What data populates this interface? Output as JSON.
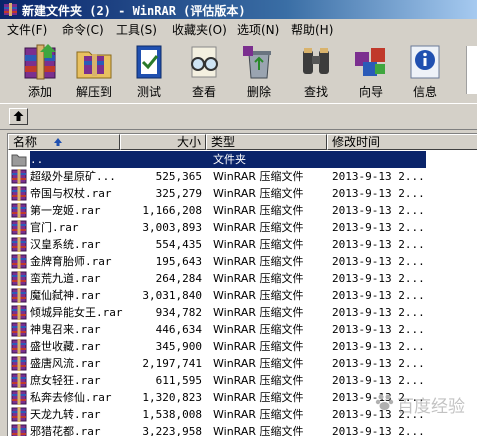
{
  "window": {
    "title": "新建文件夹 (2) - WinRAR (评估版本)"
  },
  "menu": [
    "文件(F)",
    "命令(C)",
    "工具(S)",
    "收藏夹(O)",
    "选项(N)",
    "帮助(H)"
  ],
  "toolbar": {
    "add": "添加",
    "extract": "解压到",
    "test": "测试",
    "view": "查看",
    "delete": "删除",
    "find": "查找",
    "wizard": "向导",
    "info": "信息"
  },
  "columns": {
    "name": "名称",
    "size": "大小",
    "type": "类型",
    "modified": "修改时间"
  },
  "parent_row": {
    "name": "..",
    "type": "文件夹"
  },
  "files": [
    {
      "name": "超级外星原矿...",
      "size": "525,365",
      "type": "WinRAR 压缩文件",
      "modified": "2013-9-13 2..."
    },
    {
      "name": "帝国与权杖.rar",
      "size": "325,279",
      "type": "WinRAR 压缩文件",
      "modified": "2013-9-13 2..."
    },
    {
      "name": "第一宠姬.rar",
      "size": "1,166,208",
      "type": "WinRAR 压缩文件",
      "modified": "2013-9-13 2..."
    },
    {
      "name": "官门.rar",
      "size": "3,003,893",
      "type": "WinRAR 压缩文件",
      "modified": "2013-9-13 2..."
    },
    {
      "name": "汉皇系统.rar",
      "size": "554,435",
      "type": "WinRAR 压缩文件",
      "modified": "2013-9-13 2..."
    },
    {
      "name": "金牌育胎师.rar",
      "size": "195,643",
      "type": "WinRAR 压缩文件",
      "modified": "2013-9-13 2..."
    },
    {
      "name": "蛮荒九道.rar",
      "size": "264,284",
      "type": "WinRAR 压缩文件",
      "modified": "2013-9-13 2..."
    },
    {
      "name": "魔仙弑神.rar",
      "size": "3,031,840",
      "type": "WinRAR 压缩文件",
      "modified": "2013-9-13 2..."
    },
    {
      "name": "倾城异能女王.rar",
      "size": "934,782",
      "type": "WinRAR 压缩文件",
      "modified": "2013-9-13 2..."
    },
    {
      "name": "神鬼召来.rar",
      "size": "446,634",
      "type": "WinRAR 压缩文件",
      "modified": "2013-9-13 2..."
    },
    {
      "name": "盛世收藏.rar",
      "size": "345,900",
      "type": "WinRAR 压缩文件",
      "modified": "2013-9-13 2..."
    },
    {
      "name": "盛唐风流.rar",
      "size": "2,197,741",
      "type": "WinRAR 压缩文件",
      "modified": "2013-9-13 2..."
    },
    {
      "name": "庶女轻狂.rar",
      "size": "611,595",
      "type": "WinRAR 压缩文件",
      "modified": "2013-9-13 2..."
    },
    {
      "name": "私奔去修仙.rar",
      "size": "1,320,823",
      "type": "WinRAR 压缩文件",
      "modified": "2013-9-13 2..."
    },
    {
      "name": "天龙九转.rar",
      "size": "1,538,008",
      "type": "WinRAR 压缩文件",
      "modified": "2013-9-13 2..."
    },
    {
      "name": "邪猎花都.rar",
      "size": "3,223,958",
      "type": "WinRAR 压缩文件",
      "modified": "2013-9-13 2..."
    }
  ],
  "watermark": {
    "text": "百度经验"
  },
  "colors": {
    "title_start": "#0a246a",
    "title_end": "#a6caf0",
    "selection": "#0a246a",
    "face": "#d4d0c8"
  }
}
